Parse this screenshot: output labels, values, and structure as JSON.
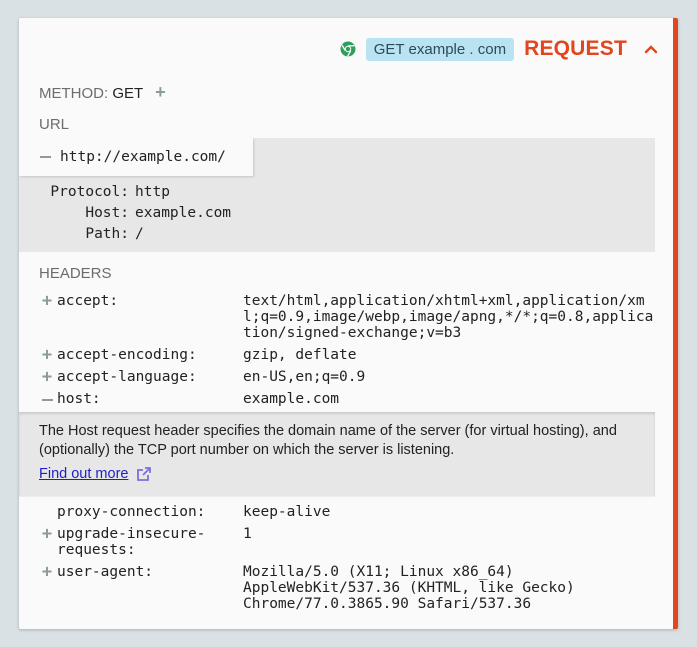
{
  "header": {
    "method_badge": "GET",
    "host_badge": "example . com",
    "title": "REQUEST",
    "browser_icon": "chrome-icon",
    "collapse_icon": "chevron-up-icon",
    "accent_color": "#e1461e"
  },
  "method": {
    "label": "METHOD:",
    "value": "GET"
  },
  "url": {
    "label": "URL",
    "value": "http://example.com/",
    "parts": [
      {
        "key": "Protocol:",
        "value": "http"
      },
      {
        "key": "Host:",
        "value": "example.com"
      },
      {
        "key": "Path:",
        "value": "/"
      }
    ]
  },
  "headers": {
    "label": "HEADERS",
    "items": [
      {
        "name": "accept:",
        "value": "text/html,application/xhtml+xml,application/xml;q=0.9,image/webp,image/apng,*/*;q=0.8,application/signed-exchange;v=b3",
        "toggle": "+"
      },
      {
        "name": "accept-encoding:",
        "value": "gzip, deflate",
        "toggle": "+"
      },
      {
        "name": "accept-language:",
        "value": "en-US,en;q=0.9",
        "toggle": "+"
      },
      {
        "name": "host:",
        "value": "example.com",
        "toggle": "-"
      },
      {
        "name": "proxy-connection:",
        "value": "keep-alive",
        "toggle": ""
      },
      {
        "name": "upgrade-insecure-\nrequests:",
        "value": "1",
        "toggle": "+"
      },
      {
        "name": "user-agent:",
        "value": "Mozilla/5.0 (X11; Linux x86_64)\nAppleWebKit/537.36 (KHTML, like Gecko)\nChrome/77.0.3865.90 Safari/537.36",
        "toggle": "+"
      }
    ],
    "host_doc": {
      "text": "The Host request header specifies the domain name of the server (for virtual hosting), and (optionally) the TCP port number on which the server is listening.",
      "link_label": "Find out more"
    }
  }
}
